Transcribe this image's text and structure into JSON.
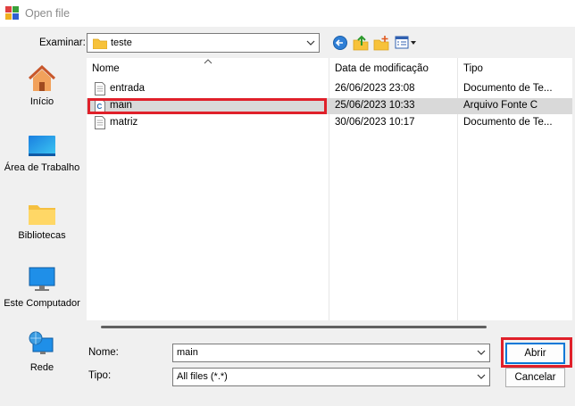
{
  "window": {
    "title": "Open file"
  },
  "lookin": {
    "label": "Examinar:",
    "value": "teste"
  },
  "toolbar": {
    "icons": [
      "back-icon",
      "up-folder-icon",
      "new-folder-icon",
      "view-menu-icon"
    ]
  },
  "places": [
    {
      "label": "Início",
      "icon": "home-icon"
    },
    {
      "label": "Área de Trabalho",
      "icon": "desktop-icon"
    },
    {
      "label": "Bibliotecas",
      "icon": "libraries-icon"
    },
    {
      "label": "Este Computador",
      "icon": "computer-icon"
    },
    {
      "label": "Rede",
      "icon": "network-icon"
    }
  ],
  "columns": {
    "name": "Nome",
    "date": "Data de modificação",
    "type": "Tipo"
  },
  "files": [
    {
      "name": "entrada",
      "date": "26/06/2023 23:08",
      "type": "Documento de Te...",
      "icon": "text-file-icon",
      "selected": false
    },
    {
      "name": "main",
      "date": "25/06/2023 10:33",
      "type": "Arquivo Fonte C",
      "icon": "c-source-file-icon",
      "selected": true
    },
    {
      "name": "matriz",
      "date": "30/06/2023 10:17",
      "type": "Documento de Te...",
      "icon": "text-file-icon",
      "selected": false
    }
  ],
  "filename": {
    "label": "Nome:",
    "value": "main"
  },
  "filetype": {
    "label": "Tipo:",
    "value": "All files (*.*)"
  },
  "buttons": {
    "open": "Abrir",
    "cancel": "Cancelar"
  },
  "colors": {
    "highlight": "#e0202a",
    "selection": "#d9d9d9",
    "folder": "#f7c23a",
    "accent": "#0078d7"
  }
}
